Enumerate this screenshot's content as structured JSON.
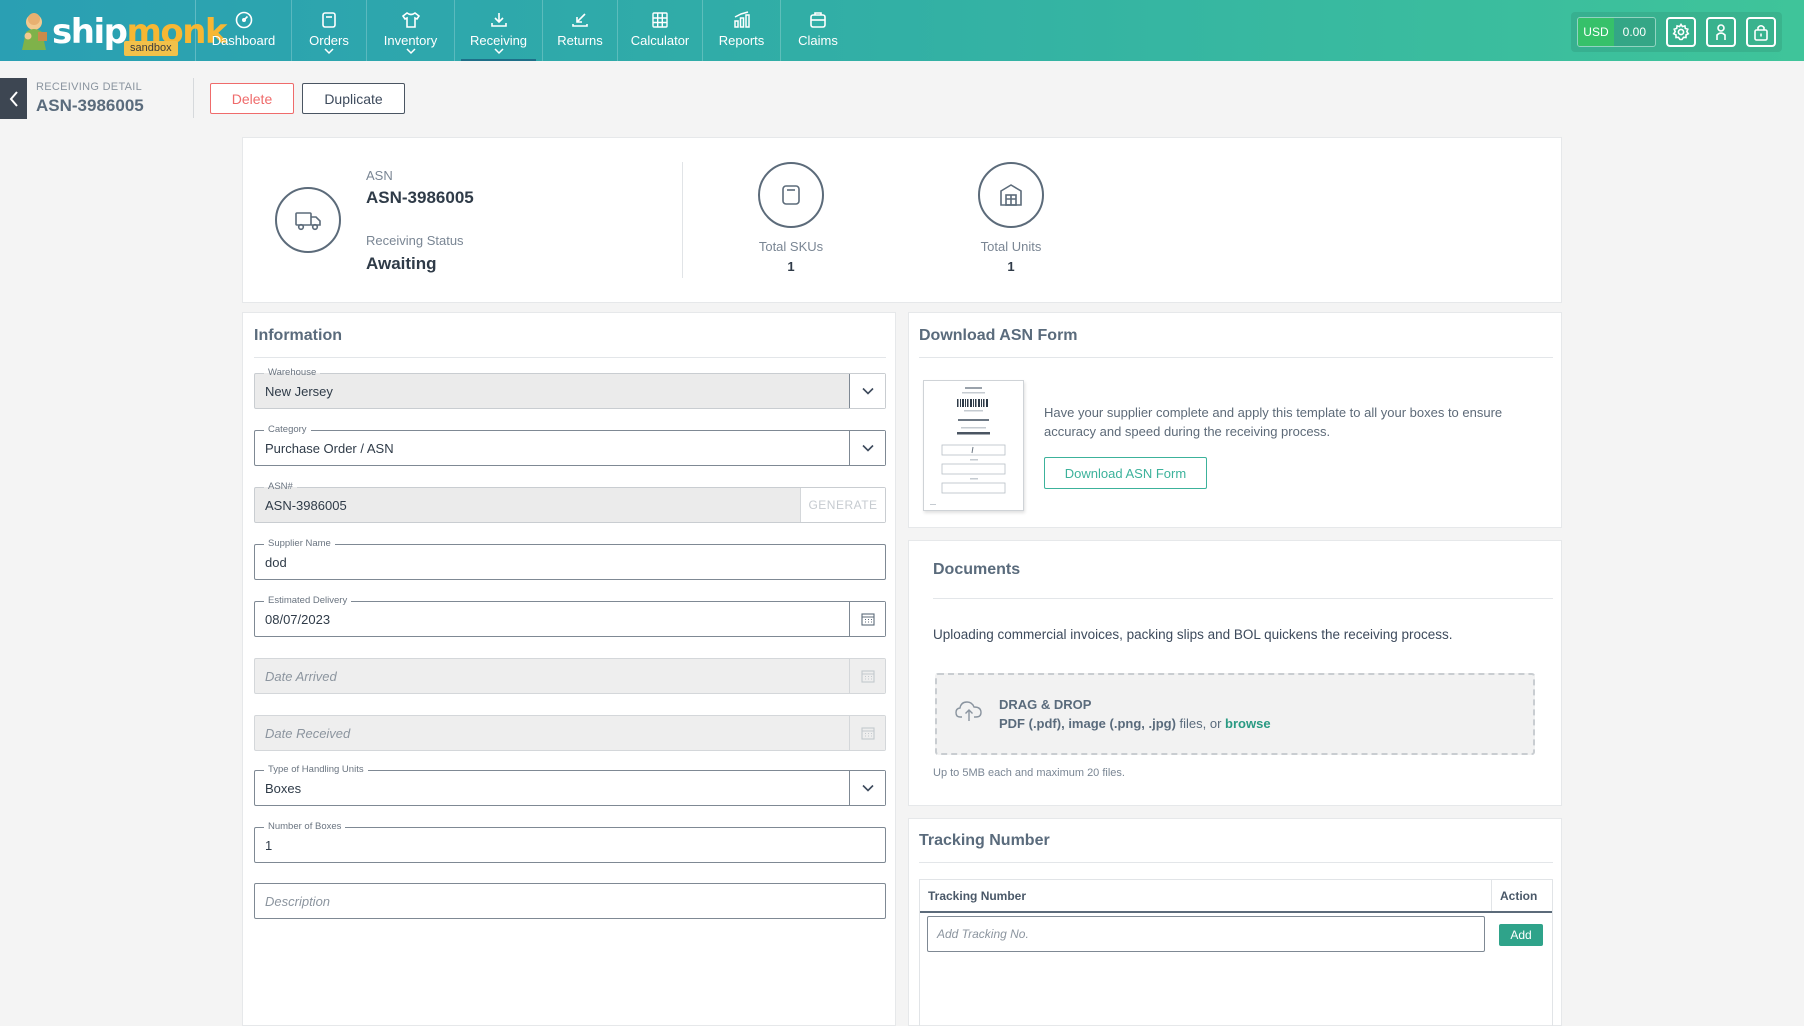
{
  "topbar": {
    "brand_main": "ship",
    "brand_accent": "monk",
    "env_badge": "sandbox",
    "nav": [
      {
        "label": "Dashboard",
        "icon": "dashboard-icon",
        "dropdown": false
      },
      {
        "label": "Orders",
        "icon": "orders-icon",
        "dropdown": true
      },
      {
        "label": "Inventory",
        "icon": "shirt-icon",
        "dropdown": true
      },
      {
        "label": "Receiving",
        "icon": "receiving-icon",
        "dropdown": true,
        "active": true
      },
      {
        "label": "Returns",
        "icon": "returns-icon",
        "dropdown": false
      },
      {
        "label": "Calculator",
        "icon": "calculator-icon",
        "dropdown": false
      },
      {
        "label": "Reports",
        "icon": "reports-icon",
        "dropdown": false
      },
      {
        "label": "Claims",
        "icon": "claims-icon",
        "dropdown": false
      }
    ],
    "currency": "USD",
    "balance": "0.00"
  },
  "subheader": {
    "label": "RECEIVING DETAIL",
    "title": "ASN-3986005",
    "delete_label": "Delete",
    "duplicate_label": "Duplicate"
  },
  "summary": {
    "asn_label": "ASN",
    "asn_value": "ASN-3986005",
    "status_label": "Receiving Status",
    "status_value": "Awaiting",
    "total_skus_label": "Total SKUs",
    "total_skus_value": "1",
    "total_units_label": "Total Units",
    "total_units_value": "1"
  },
  "information": {
    "title": "Information",
    "warehouse": {
      "label": "Warehouse",
      "value": "New Jersey"
    },
    "category": {
      "label": "Category",
      "value": "Purchase Order / ASN"
    },
    "asn": {
      "label": "ASN#",
      "value": "ASN-3986005",
      "generate": "GENERATE"
    },
    "supplier": {
      "label": "Supplier Name",
      "value": "dod"
    },
    "est_delivery": {
      "label": "Estimated Delivery",
      "value": "08/07/2023"
    },
    "date_arrived": {
      "placeholder": "Date Arrived"
    },
    "date_received": {
      "placeholder": "Date Received"
    },
    "handling": {
      "label": "Type of Handling Units",
      "value": "Boxes"
    },
    "boxes": {
      "label": "Number of Boxes",
      "value": "1"
    },
    "description": {
      "placeholder": "Description"
    }
  },
  "download": {
    "title": "Download ASN Form",
    "text_line1": "Have your supplier complete and apply this template to all your boxes to ensure",
    "text_line2": "accuracy and speed during the receiving process.",
    "button": "Download ASN Form"
  },
  "documents": {
    "title": "Documents",
    "intro": "Uploading commercial invoices, packing slips and BOL quickens the receiving process.",
    "drop_title": "DRAG & DROP",
    "drop_types": "PDF (.pdf), image (.png, .jpg)",
    "drop_middle": " files, or ",
    "drop_browse": "browse",
    "note": "Up to 5MB each and maximum 20 files."
  },
  "tracking": {
    "title": "Tracking Number",
    "col_number": "Tracking Number",
    "col_action": "Action",
    "input_placeholder": "Add Tracking No.",
    "add_label": "Add"
  },
  "colors": {
    "accent_green": "#2fa38a",
    "danger": "#ef6b6b",
    "nav_start": "#2a9fb3",
    "nav_end": "#3fc49a"
  }
}
